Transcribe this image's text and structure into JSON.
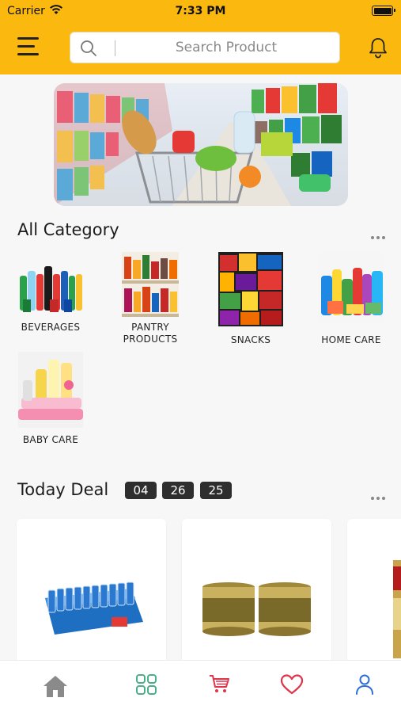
{
  "status_bar": {
    "carrier": "Carrier",
    "time": "7:33 PM"
  },
  "header": {
    "search_placeholder": "Search Product",
    "accent_color": "#fbb80f"
  },
  "categories": {
    "title": "All Category",
    "items": [
      {
        "label": "BEVERAGES"
      },
      {
        "label": "PANTRY PRODUCTS"
      },
      {
        "label": "SNACKS"
      },
      {
        "label": "HOME CARE"
      },
      {
        "label": "BABY CARE"
      }
    ]
  },
  "today_deal": {
    "title": "Today Deal",
    "timer": {
      "hours": "04",
      "minutes": "26",
      "seconds": "25"
    }
  },
  "bottom_nav": {
    "items": [
      {
        "icon": "home-icon",
        "color": "#8a8a8a"
      },
      {
        "icon": "grid-icon",
        "color": "#4caf8a"
      },
      {
        "icon": "cart-icon",
        "color": "#e0334a"
      },
      {
        "icon": "heart-icon",
        "color": "#e0334a"
      },
      {
        "icon": "user-icon",
        "color": "#2b6fd6"
      }
    ]
  }
}
